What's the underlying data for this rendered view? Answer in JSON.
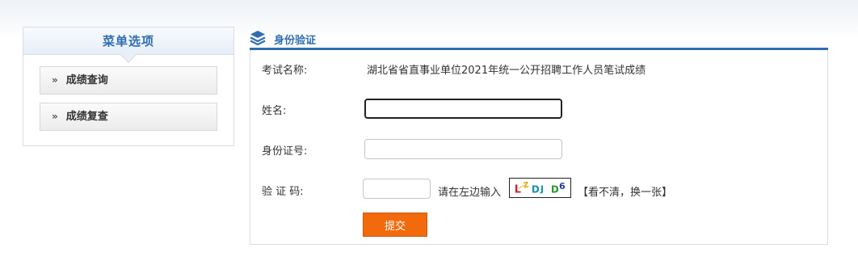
{
  "sidebar": {
    "title": "菜单选项",
    "items": [
      {
        "arrow": "»",
        "label": "成绩查询"
      },
      {
        "arrow": "»",
        "label": "成绩复查"
      }
    ]
  },
  "main": {
    "icon": "layers-icon",
    "title": "身份验证"
  },
  "form": {
    "exam_label": "考试名称:",
    "exam_value": "湖北省省直事业单位2021年统一公开招聘工作人员笔试成绩",
    "name_label": "姓名:",
    "name_value": "",
    "id_label": "身份证号:",
    "id_value": "",
    "code_label": "验 证 码:",
    "code_value": "",
    "captcha_hint": "请在左边输入",
    "captcha_chars": [
      "L",
      "Z",
      "D",
      "J",
      "D",
      "6"
    ],
    "captcha_colors": [
      "#d42020",
      "#d9a800",
      "#1a8fa8",
      "#1a8fa8",
      "#2a9a2a",
      "#1a3f9a"
    ],
    "refresh_text": "【看不清，换一张】",
    "submit_label": "提交"
  },
  "colors": {
    "accent": "#2f6db0",
    "submit": "#f26a0c"
  }
}
